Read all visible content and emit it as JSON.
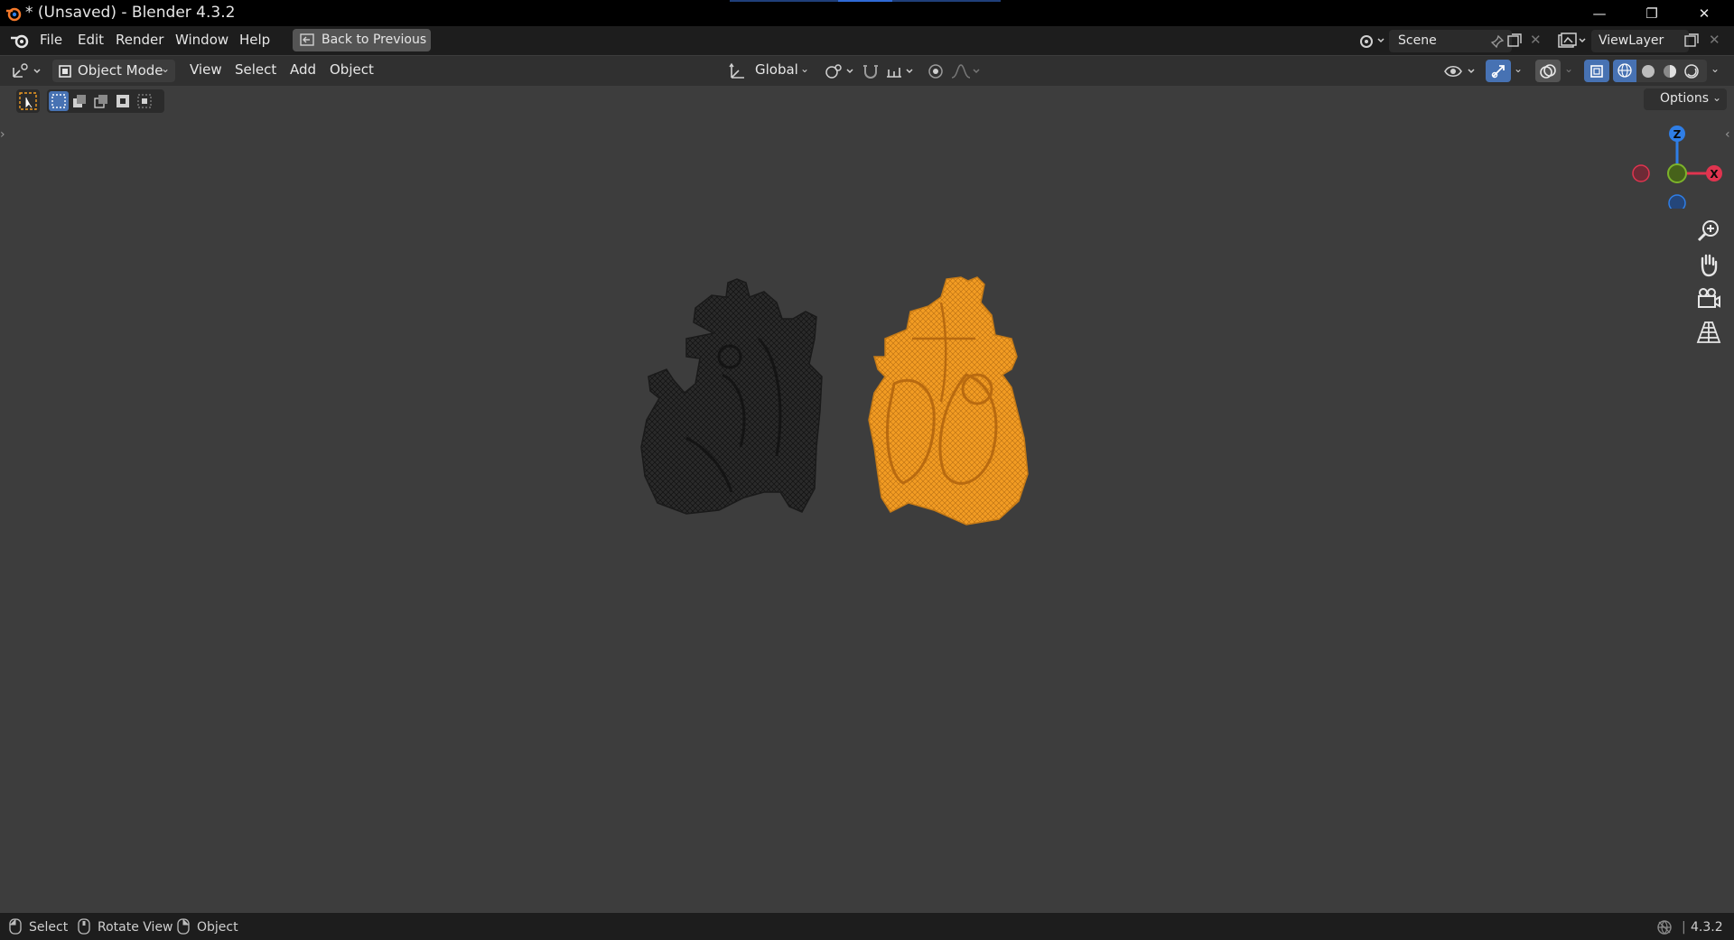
{
  "window": {
    "title": "* (Unsaved) - Blender 4.3.2",
    "minimize_label": "—",
    "restore_label": "❐",
    "close_label": "✕"
  },
  "menubar": {
    "items": [
      "File",
      "Edit",
      "Render",
      "Window",
      "Help"
    ],
    "back_button": "Back to Previous",
    "scene": "Scene",
    "view_layer": "ViewLayer"
  },
  "header": {
    "mode": "Object Mode",
    "menus": [
      "View",
      "Select",
      "Add",
      "Object"
    ],
    "transform_orientation": "Global",
    "options": "Options"
  },
  "gizmo": {
    "z_label": "Z",
    "x_label": "X"
  },
  "viewport": {
    "objects": [
      {
        "name": "heart-mesh-dark",
        "color": "#1e1e1e"
      },
      {
        "name": "heart-mesh-selected",
        "color": "#f29c23"
      }
    ]
  },
  "statusbar": {
    "select": "Select",
    "rotate": "Rotate View",
    "object": "Object",
    "version": "4.3.2"
  },
  "colors": {
    "accent_selected": "#f29c23",
    "axis_x": "#e0344f",
    "axis_y": "#7cb32a",
    "axis_z": "#2f7ee6"
  }
}
